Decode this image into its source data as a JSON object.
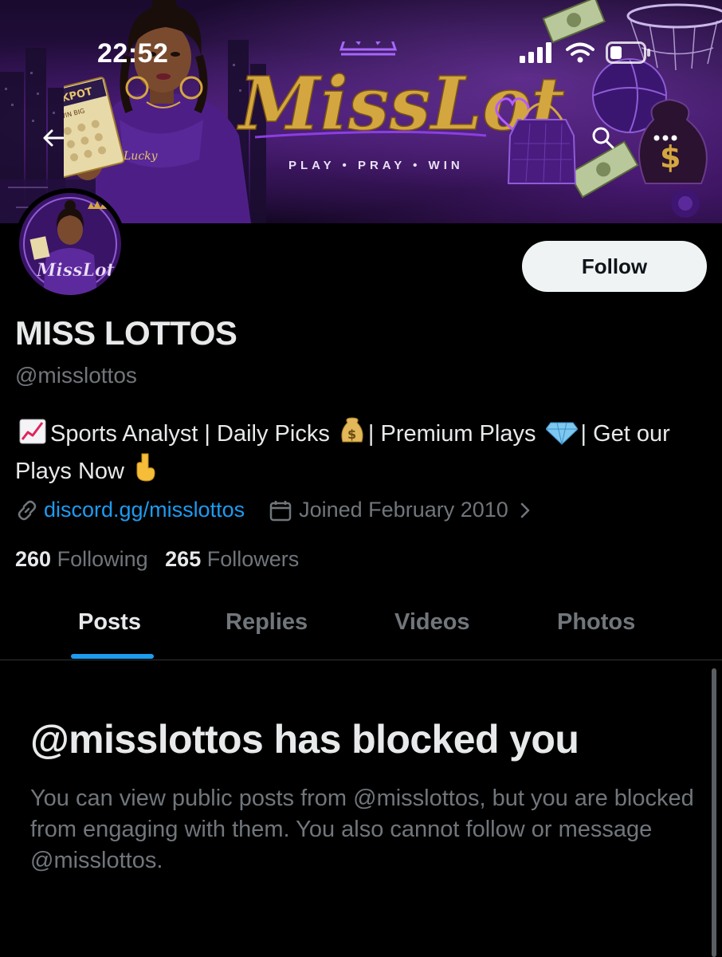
{
  "status_bar": {
    "time": "22:52"
  },
  "banner": {
    "brand": "MissLottos",
    "tagline": "PLAY • PRAY • WIN",
    "scratch_card": {
      "title": "JACKPOT",
      "subtitle": "WIN BIG"
    },
    "hoodie_text": "Lucky"
  },
  "avatar": {
    "brand": "MissLottos"
  },
  "profile": {
    "follow_label": "Follow",
    "display_name": "MISS LOTTOS",
    "handle": "@misslottos",
    "bio": {
      "part1": "Sports Analyst | Daily Picks",
      "part2": "| Premium Plays",
      "part3": "| Get our Plays Now"
    },
    "link": "discord.gg/misslottos",
    "joined": "Joined February 2010",
    "following_count": "260",
    "following_label": "Following",
    "followers_count": "265",
    "followers_label": "Followers"
  },
  "tabs": [
    {
      "label": "Posts",
      "active": true
    },
    {
      "label": "Replies",
      "active": false
    },
    {
      "label": "Videos",
      "active": false
    },
    {
      "label": "Photos",
      "active": false
    }
  ],
  "blocked": {
    "title": "@misslottos has blocked you",
    "body": "You can view public posts from @misslottos, but you are blocked from engaging with them. You also cannot follow or message @misslottos."
  },
  "colors": {
    "background": "#000000",
    "text_primary": "#e7e9ea",
    "text_secondary": "#71767b",
    "accent": "#1d9bf0",
    "follow_bg": "#eff3f4",
    "brand_gold": "#d4a640",
    "brand_purple": "#6a2fa8"
  },
  "icons": {
    "back": "arrow-left-icon",
    "search": "search-icon",
    "more": "more-dots-icon",
    "link": "link-icon",
    "calendar": "calendar-icon",
    "chevron": "chevron-right-icon",
    "signal": "signal-icon",
    "wifi": "wifi-icon",
    "battery": "battery-icon"
  }
}
